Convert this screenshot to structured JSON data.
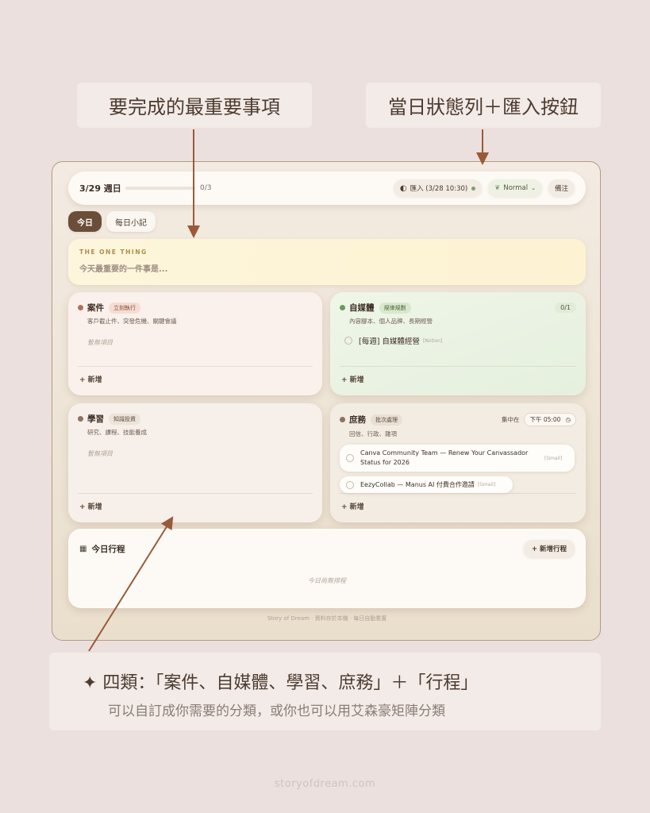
{
  "callouts": {
    "left": "要完成的最重要事項",
    "right": "當日狀態列＋匯入按鈕"
  },
  "topbar": {
    "date": "3/29 週日",
    "progress_value": 0,
    "progress_text": "0/3",
    "import_label": "匯入 (3/28 10:30)",
    "mode_label": "Normal",
    "notes_label": "備注"
  },
  "tabs": [
    {
      "label": "今日",
      "active": true
    },
    {
      "label": "每日小記",
      "active": false
    }
  ],
  "one_thing": {
    "label": "THE ONE THING",
    "placeholder": "今天最重要的一件事是..."
  },
  "cards": {
    "cases": {
      "title": "案件",
      "tag": "立刻執行",
      "subtitle": "客戶截止件、突發危機、關鍵會議",
      "empty": "暫無項目",
      "add": "+ 新增",
      "color": "#b3705a",
      "bg": "#faf1ec"
    },
    "media": {
      "title": "自媒體",
      "tag": "規律規劃",
      "subtitle": "內容腳本、個人品牌、長期經營",
      "count": "0/1",
      "task": "[每週] 自媒體經營",
      "task_src": "[Notion]",
      "add": "+ 新增",
      "color": "#6c9a5c",
      "bg": "#eaf3e2"
    },
    "study": {
      "title": "學習",
      "tag": "知識投資",
      "subtitle": "研究、課程、技能養成",
      "empty": "暫無項目",
      "add": "+ 新增",
      "color": "#8c7361",
      "bg": "#f6efe8"
    },
    "admin": {
      "title": "庶務",
      "tag": "批次處理",
      "subtitle": "回信、行政、雜項",
      "focus_label": "集中在",
      "focus_time": "下午 05:00",
      "mails": [
        {
          "text": "Canva Community Team — Renew Your Canvassador Status for 2026",
          "src": "[Gmail]"
        },
        {
          "text": "EezyCollab — Manus AI 付費合作邀請",
          "src": "[Gmail]"
        }
      ],
      "add": "+ 新增",
      "color": "#8c7361",
      "bg": "#f3ece2"
    }
  },
  "schedule": {
    "title": "今日行程",
    "add_label": "+ 新增行程",
    "empty": "今日尚無排程"
  },
  "footer": "Story of Dream · 資料存於本機 · 每日自動重置",
  "bottom": {
    "headline": "✦ 四類：「案件、自媒體、學習、庶務」＋「行程」",
    "subline": "可以自訂成你需要的分類，或你也可以用艾森豪矩陣分類"
  },
  "site": "storyofdream.com"
}
